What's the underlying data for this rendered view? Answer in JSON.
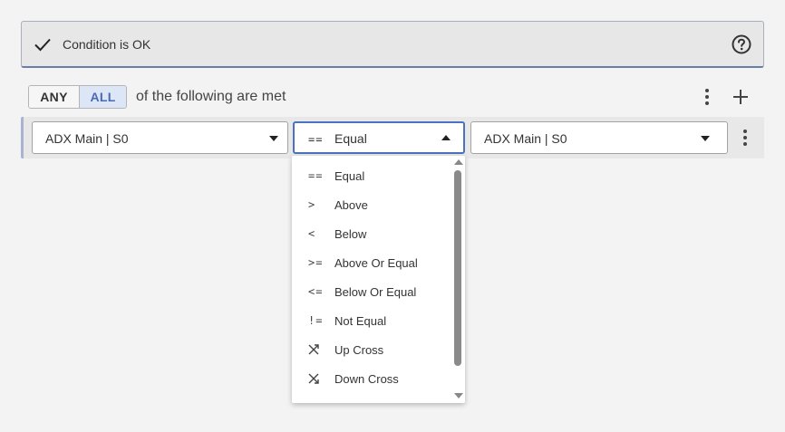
{
  "status": {
    "text": "Condition is OK",
    "icon": "check-icon",
    "help_icon": "help-circle-icon"
  },
  "mode": {
    "any_label": "ANY",
    "all_label": "ALL",
    "selected": "ALL",
    "suffix": "of the following are met"
  },
  "condition": {
    "left_value": "ADX Main | S0",
    "operator_symbol": "==",
    "operator_label": "Equal",
    "right_value": "ADX Main | S0"
  },
  "operator_options": [
    {
      "symbol": "==",
      "label": "Equal"
    },
    {
      "symbol": ">",
      "label": "Above"
    },
    {
      "symbol": "<",
      "label": "Below"
    },
    {
      "symbol": ">=",
      "label": "Above Or Equal"
    },
    {
      "symbol": "<=",
      "label": "Below Or Equal"
    },
    {
      "symbol": "!=",
      "label": "Not Equal"
    },
    {
      "symbol": "",
      "icon": "up-cross-icon",
      "label": "Up Cross"
    },
    {
      "symbol": "",
      "icon": "down-cross-icon",
      "label": "Down Cross"
    }
  ],
  "colors": {
    "accent": "#4a72c0",
    "all_selected_bg": "#dde6f7",
    "all_selected_text": "#4a6ab0",
    "row_accent": "#a6b3d2"
  }
}
